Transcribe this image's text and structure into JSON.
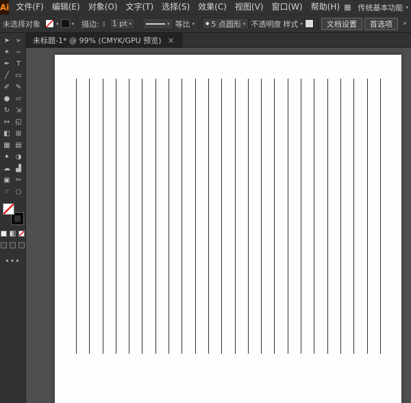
{
  "menu_bar": {
    "logo_text": "Ai",
    "items": [
      "文件(F)",
      "编辑(E)",
      "对象(O)",
      "文字(T)",
      "选择(S)",
      "效果(C)",
      "视图(V)",
      "窗口(W)",
      "帮助(H)"
    ],
    "workspace_label": "传统基本功能"
  },
  "control_bar": {
    "status_label": "未选择对象",
    "stroke_label": "描边:",
    "stroke_value": "1 pt",
    "profile_value": "等比",
    "brush_value": "5 点圆形",
    "opacity_label": "不透明度",
    "style_label": "样式",
    "doc_setup_button": "文档设置",
    "preferences_button": "首选项"
  },
  "toolbar": {
    "tools": [
      {
        "name": "selection-tool",
        "glyph": "➤"
      },
      {
        "name": "direct-selection-tool",
        "glyph": "➢"
      },
      {
        "name": "magic-wand-tool",
        "glyph": "✶"
      },
      {
        "name": "lasso-tool",
        "glyph": "∽"
      },
      {
        "name": "pen-tool",
        "glyph": "✒"
      },
      {
        "name": "type-tool",
        "glyph": "T"
      },
      {
        "name": "line-segment-tool",
        "glyph": "╱"
      },
      {
        "name": "rectangle-tool",
        "glyph": "▭"
      },
      {
        "name": "paintbrush-tool",
        "glyph": "✐"
      },
      {
        "name": "pencil-tool",
        "glyph": "✎"
      },
      {
        "name": "blob-brush-tool",
        "glyph": "●"
      },
      {
        "name": "eraser-tool",
        "glyph": "▱"
      },
      {
        "name": "rotate-tool",
        "glyph": "↻"
      },
      {
        "name": "scale-tool",
        "glyph": "⇲"
      },
      {
        "name": "width-tool",
        "glyph": "↔"
      },
      {
        "name": "free-transform-tool",
        "glyph": "◱"
      },
      {
        "name": "shape-builder-tool",
        "glyph": "◧"
      },
      {
        "name": "perspective-grid-tool",
        "glyph": "⊞"
      },
      {
        "name": "mesh-tool",
        "glyph": "▦"
      },
      {
        "name": "gradient-tool",
        "glyph": "▤"
      },
      {
        "name": "eyedropper-tool",
        "glyph": "✦"
      },
      {
        "name": "blend-tool",
        "glyph": "◑"
      },
      {
        "name": "symbol-sprayer-tool",
        "glyph": "☁"
      },
      {
        "name": "column-graph-tool",
        "glyph": "▟"
      },
      {
        "name": "artboard-tool",
        "glyph": "▣"
      },
      {
        "name": "slice-tool",
        "glyph": "✂"
      },
      {
        "name": "hand-tool",
        "glyph": "☞"
      },
      {
        "name": "zoom-tool",
        "glyph": "○"
      }
    ],
    "swatch_buttons": [
      {
        "name": "color-button"
      },
      {
        "name": "gradient-button"
      },
      {
        "name": "none-button"
      }
    ],
    "mode_buttons": [
      {
        "name": "draw-normal-button"
      },
      {
        "name": "draw-behind-button"
      },
      {
        "name": "draw-inside-button"
      }
    ]
  },
  "document_tabs": {
    "active_title": "未标题-1* @ 99% (CMYK/GPU 预览)",
    "close_glyph": "×"
  },
  "artboard": {
    "line_count": 24,
    "line_color": "#2f2f2f"
  },
  "icons": {
    "chevron_down": "▾",
    "spinner_up": "▴",
    "spinner_down": "▾",
    "arrange_glyph": "▦",
    "overflow_glyph": "»",
    "ellipsis": "•••",
    "brush_dot": "●"
  },
  "colors": {
    "chrome": "#323232",
    "canvas_bg": "#4e4e4e",
    "artboard_bg": "#fefefe",
    "logo_orange": "#ff8c1a",
    "none_red": "#e32424"
  }
}
